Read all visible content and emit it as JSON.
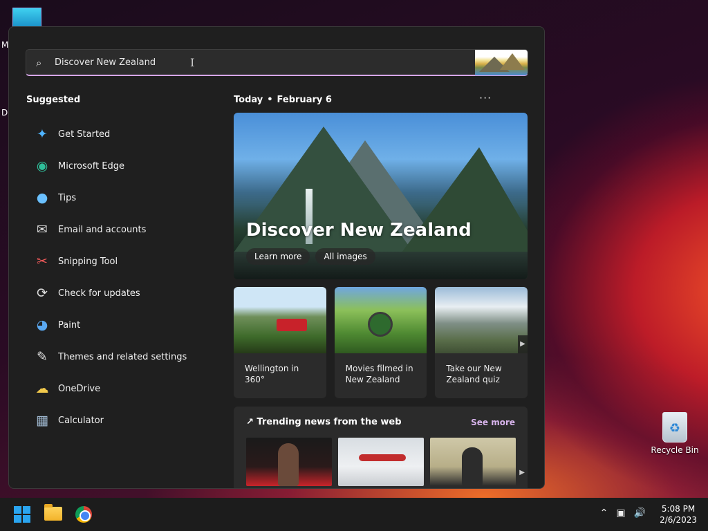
{
  "desktop": {
    "partial_label_1": "M",
    "partial_label_2": "Da",
    "recycle_bin": "Recycle Bin"
  },
  "search": {
    "value": "Discover New Zealand"
  },
  "suggested": {
    "title": "Suggested",
    "items": [
      {
        "label": "Get Started",
        "icon": "get-started-icon"
      },
      {
        "label": "Microsoft Edge",
        "icon": "edge-icon"
      },
      {
        "label": "Tips",
        "icon": "tips-icon"
      },
      {
        "label": "Email and accounts",
        "icon": "mail-icon"
      },
      {
        "label": "Snipping Tool",
        "icon": "snipping-tool-icon"
      },
      {
        "label": "Check for updates",
        "icon": "refresh-icon"
      },
      {
        "label": "Paint",
        "icon": "paint-icon"
      },
      {
        "label": "Themes and related settings",
        "icon": "brush-icon"
      },
      {
        "label": "OneDrive",
        "icon": "onedrive-icon"
      },
      {
        "label": "Calculator",
        "icon": "calculator-icon"
      }
    ]
  },
  "today": {
    "label": "Today",
    "date": "February 6",
    "more": "···"
  },
  "hero": {
    "title": "Discover New Zealand",
    "learn_more": "Learn more",
    "all_images": "All images"
  },
  "cards": [
    {
      "caption": "Wellington in 360°"
    },
    {
      "caption": "Movies filmed in New Zealand"
    },
    {
      "caption": "Take our New Zealand quiz"
    }
  ],
  "trending": {
    "title": "Trending news from the web",
    "see_more": "See more"
  },
  "taskbar": {
    "time": "5:08 PM",
    "date": "2/6/2023"
  },
  "colors": {
    "accent": "#d6a6e8",
    "see_more": "#d8b4ec",
    "panel_bg": "#1f1f1f"
  }
}
